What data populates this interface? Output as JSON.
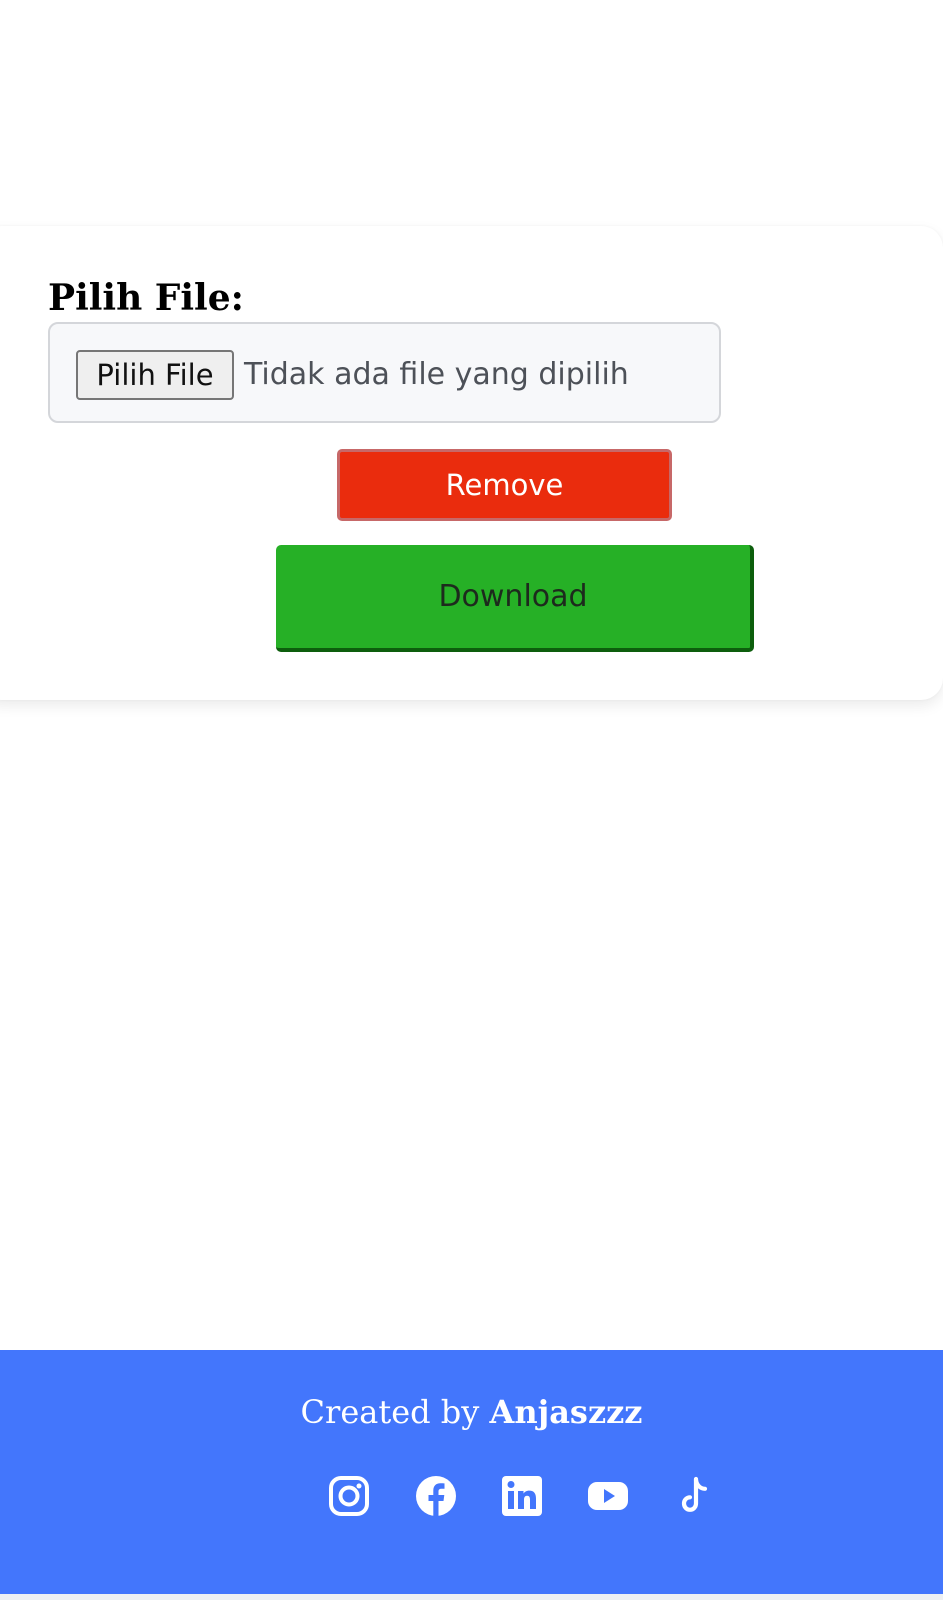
{
  "form": {
    "label": "Pilih File:",
    "file_button_label": "Pilih File",
    "file_status": "Tidak ada file yang dipilih",
    "remove_label": "Remove",
    "download_label": "Download"
  },
  "footer": {
    "credit_prefix": "Created by",
    "credit_name": "Anjaszzz",
    "socials": [
      {
        "icon": "instagram-icon"
      },
      {
        "icon": "facebook-icon"
      },
      {
        "icon": "linkedin-icon"
      },
      {
        "icon": "youtube-icon"
      },
      {
        "icon": "tiktok-icon"
      }
    ]
  },
  "colors": {
    "remove": "#ea2c0d",
    "download": "#26b026",
    "footer": "#4376fc"
  }
}
